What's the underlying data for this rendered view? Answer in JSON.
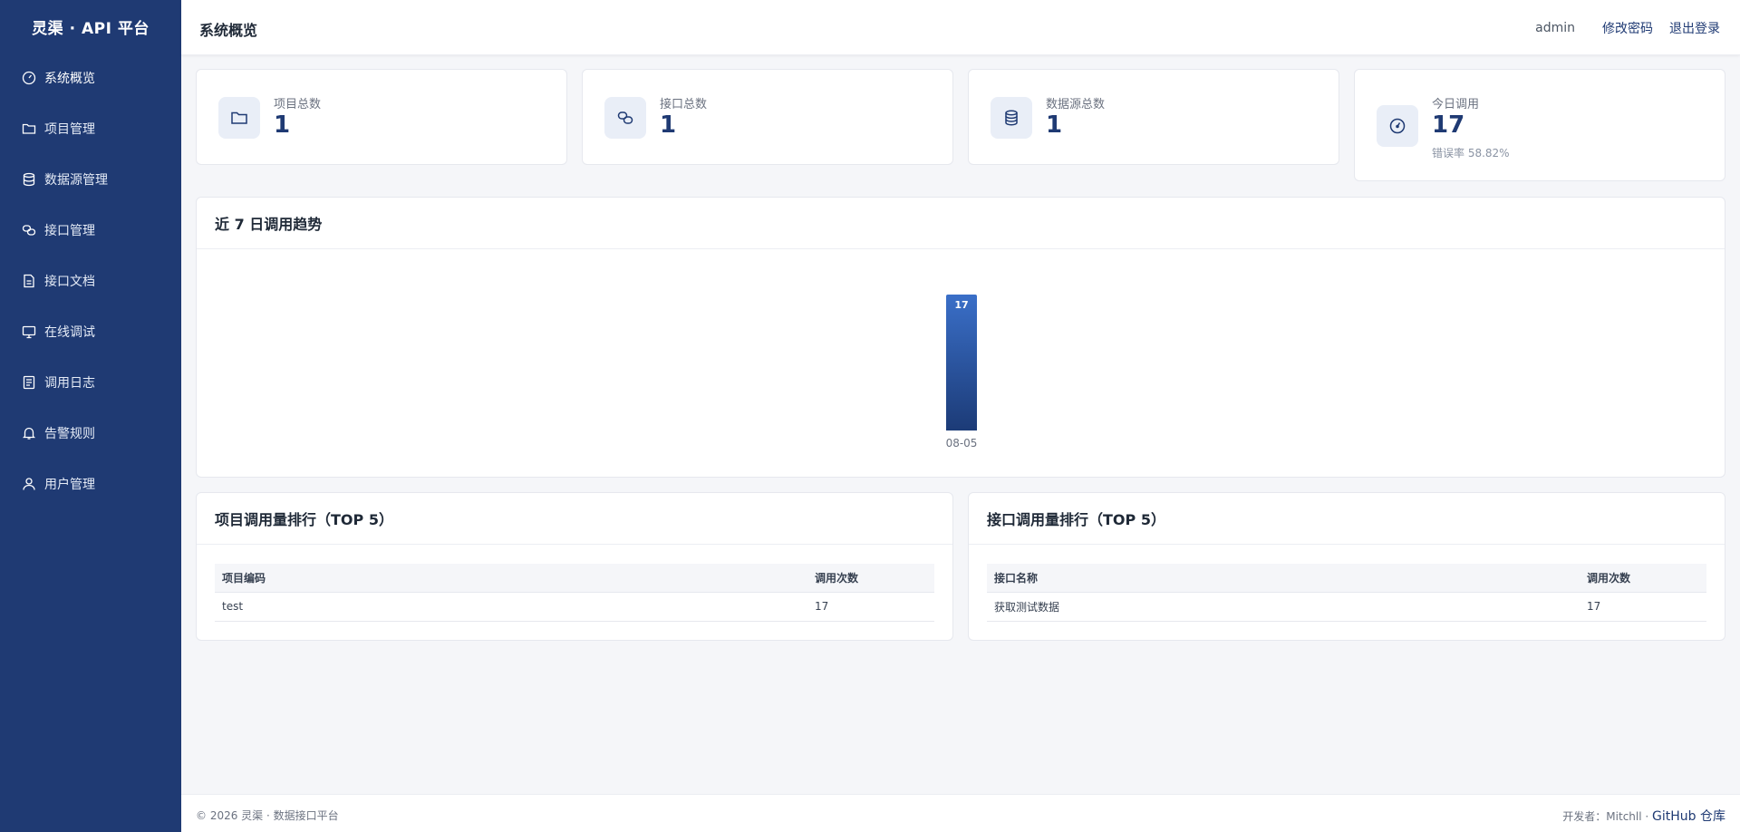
{
  "brand": "灵渠 · API 平台",
  "nav": [
    {
      "label": "系统概览",
      "icon": "gauge-icon"
    },
    {
      "label": "项目管理",
      "icon": "folder-icon"
    },
    {
      "label": "数据源管理",
      "icon": "database-icon"
    },
    {
      "label": "接口管理",
      "icon": "link-icon"
    },
    {
      "label": "接口文档",
      "icon": "document-icon"
    },
    {
      "label": "在线调试",
      "icon": "monitor-icon"
    },
    {
      "label": "调用日志",
      "icon": "log-icon"
    },
    {
      "label": "告警规则",
      "icon": "bell-icon"
    },
    {
      "label": "用户管理",
      "icon": "user-icon"
    }
  ],
  "header": {
    "title": "系统概览",
    "user": "admin",
    "change_password": "修改密码",
    "logout": "退出登录"
  },
  "stats": [
    {
      "label": "项目总数",
      "value": "1",
      "icon": "folder-icon"
    },
    {
      "label": "接口总数",
      "value": "1",
      "icon": "link-icon"
    },
    {
      "label": "数据源总数",
      "value": "1",
      "icon": "database-icon"
    },
    {
      "label": "今日调用",
      "value": "17",
      "sub": "错误率 58.82%",
      "icon": "gauge-icon"
    }
  ],
  "trend": {
    "title": "近 7 日调用趋势"
  },
  "chart_data": {
    "type": "bar",
    "categories": [
      "08-05"
    ],
    "values": [
      17
    ],
    "title": "近 7 日调用趋势"
  },
  "project_rank": {
    "title": "项目调用量排行（TOP 5）",
    "columns": [
      "项目编码",
      "调用次数"
    ],
    "rows": [
      [
        "test",
        "17"
      ]
    ]
  },
  "api_rank": {
    "title": "接口调用量排行（TOP 5）",
    "columns": [
      "接口名称",
      "调用次数"
    ],
    "rows": [
      [
        "获取测试数据",
        "17"
      ]
    ]
  },
  "footer": {
    "copyright": "© 2026 灵渠 · 数据接口平台",
    "developer": "开发者：Mitchll ·",
    "github": "GitHub 仓库"
  },
  "colors": {
    "sidebar": "#1f3a73",
    "accent": "#1f3a73",
    "bar_top": "#3a6fc8",
    "bar_bottom": "#1c3b77"
  }
}
